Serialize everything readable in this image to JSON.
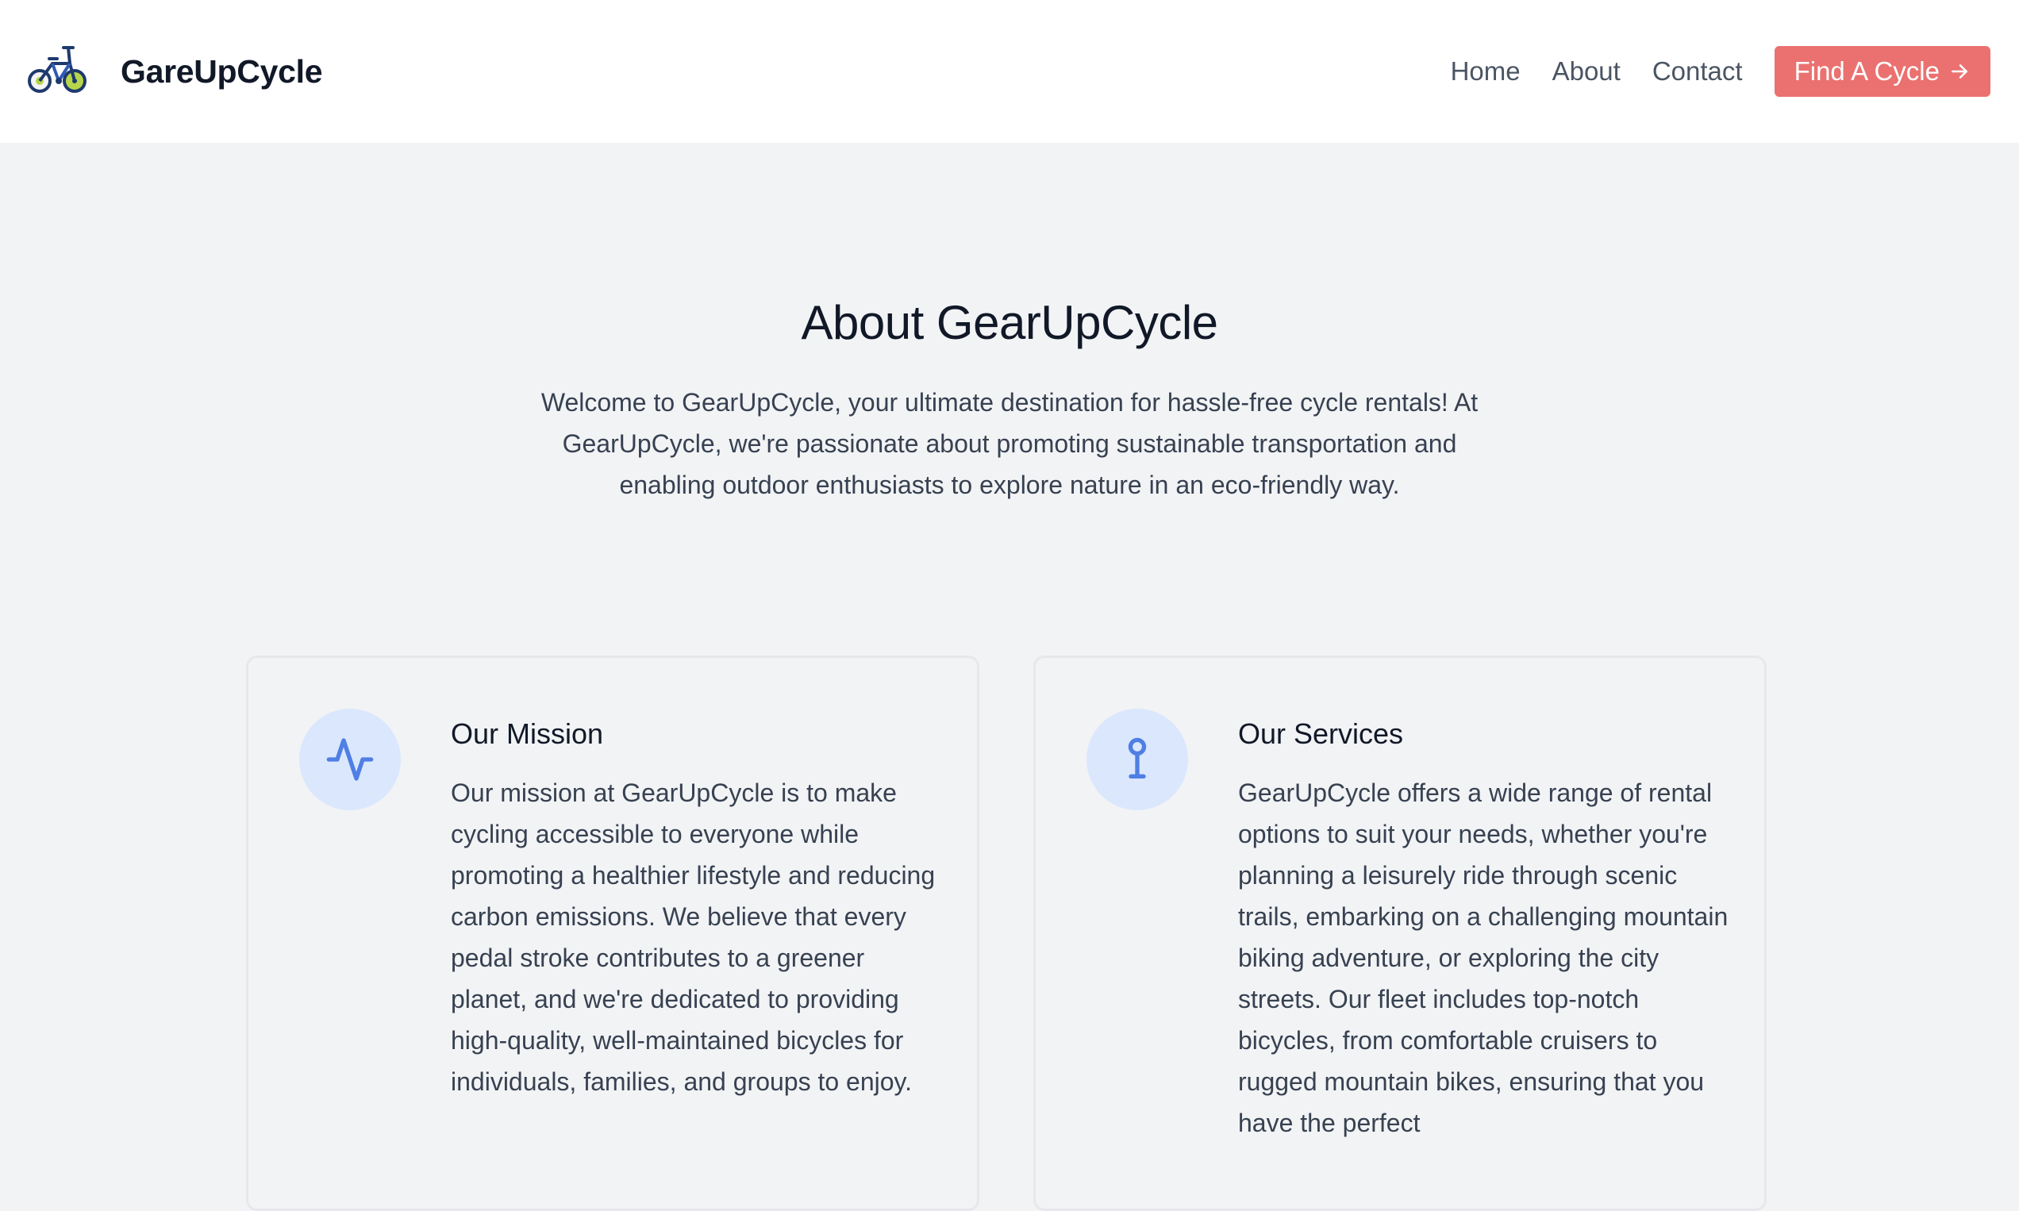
{
  "header": {
    "brand_name": "GareUpCycle",
    "logo_icon": "bicycle-logo-icon",
    "nav": [
      {
        "label": "Home"
      },
      {
        "label": "About"
      },
      {
        "label": "Contact"
      }
    ],
    "cta": {
      "label": "Find A Cycle",
      "icon": "arrow-right-icon",
      "color": "#ea7170"
    }
  },
  "hero": {
    "title": "About GearUpCycle",
    "text": "Welcome to GearUpCycle, your ultimate destination for hassle-free cycle rentals! At GearUpCycle, we're passionate about promoting sustainable transportation and enabling outdoor enthusiasts to explore nature in an eco-friendly way."
  },
  "cards": [
    {
      "icon": "activity-icon",
      "title": "Our Mission",
      "text": "Our mission at GearUpCycle is to make cycling accessible to everyone while promoting a healthier lifestyle and reducing carbon emissions. We believe that every pedal stroke contributes to a greener planet, and we're dedicated to providing high-quality, well-maintained bicycles for individuals, families, and groups to enjoy."
    },
    {
      "icon": "map-pin-icon",
      "title": "Our Services",
      "text": "GearUpCycle offers a wide range of rental options to suit your needs, whether you're planning a leisurely ride through scenic trails, embarking on a challenging mountain biking adventure, or exploring the city streets. Our fleet includes top-notch bicycles, from comfortable cruisers to rugged mountain bikes, ensuring that you have the perfect"
    }
  ],
  "colors": {
    "accent": "#ea7170",
    "icon_blue": "#4f7fe3",
    "icon_circle": "#dbe7fd",
    "page_bg": "#f2f3f5"
  }
}
